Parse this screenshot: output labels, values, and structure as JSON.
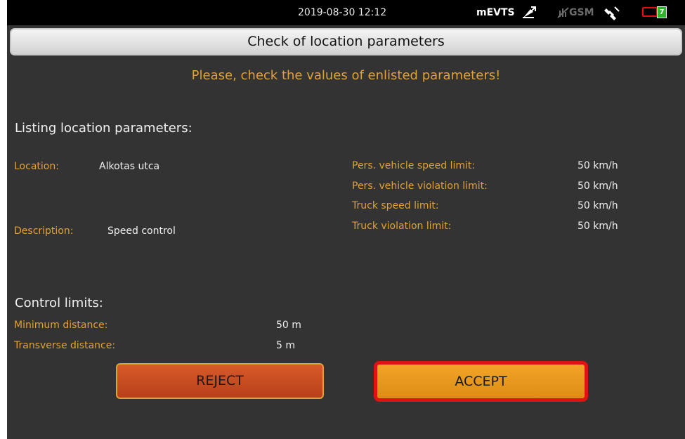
{
  "statusbar": {
    "datetime": "2019-08-30 12:12",
    "app_name": "mEVTS",
    "gsm_label": "GSM",
    "battery_level_label": "7",
    "icons": [
      "upload-icon",
      "no-gsm-signal-icon",
      "satellite-icon",
      "battery-icon"
    ]
  },
  "title": "Check of location parameters",
  "warning": "Please, check the values of enlisted parameters!",
  "location_section": {
    "heading": "Listing location parameters:",
    "location_label": "Location:",
    "location_value": "Alkotas utca",
    "description_label": "Description:",
    "description_value": "Speed control"
  },
  "limits": [
    {
      "label": "Pers. vehicle speed limit:",
      "value": "50 km/h"
    },
    {
      "label": "Pers. vehicle violation limit:",
      "value": "50 km/h"
    },
    {
      "label": "Truck speed limit:",
      "value": "50 km/h"
    },
    {
      "label": "Truck violation limit:",
      "value": "50 km/h"
    }
  ],
  "control_limits": {
    "heading": "Control limits:",
    "items": [
      {
        "label": "Minimum distance:",
        "value": "50 m"
      },
      {
        "label": "Transverse distance:",
        "value": "5 m"
      }
    ]
  },
  "buttons": {
    "reject": "REJECT",
    "accept": "ACCEPT"
  },
  "colors": {
    "background": "#333333",
    "label": "#e2a233",
    "accept": "#f2a528",
    "reject": "#d85a2a",
    "highlight_border": "#e31212"
  }
}
